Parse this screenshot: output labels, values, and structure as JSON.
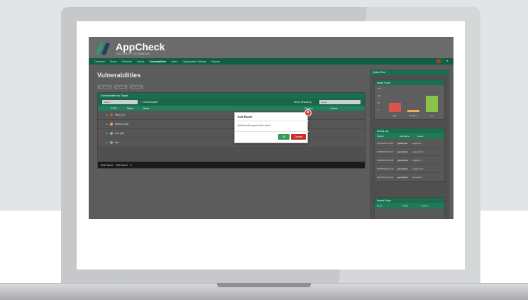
{
  "app": {
    "logo_text": "AppCheck",
    "logo_sub": "SECURITY SCANNING"
  },
  "nav": {
    "items": [
      "Overview",
      "Scans",
      "Schedule",
      "Assets",
      "Vulnerabilities",
      "Users",
      "Organisation Settings",
      "Support"
    ],
    "active": "Vulnerabilities"
  },
  "page": {
    "title": "Vulnerabilities",
    "toolbar": [
      "By Target",
      "By Scan",
      "By Date"
    ]
  },
  "panel": {
    "title": "Vulnerabilities by Target",
    "filter_placeholder": "Search",
    "filter_check": "Hide Accepted",
    "group_label": "Group Results By",
    "group_value": "Target",
    "columns": [
      "CVSS",
      "Status",
      "Name",
      "Scanner",
      "Actions"
    ],
    "rows": [
      {
        "label": "High (12)",
        "color": "#d9534f"
      },
      {
        "label": "Medium (35)",
        "color": "#f0ad4e"
      },
      {
        "label": "Low (86)",
        "color": "#5bc0de"
      },
      {
        "label": "Info",
        "color": "#9e9e9e"
      }
    ],
    "footer": [
      "Bulk Report",
      "Edit Report",
      "0"
    ]
  },
  "side": {
    "title": "Quick View",
    "chart_title": "Issues Found",
    "y_ticks": [
      "150",
      "100",
      "50",
      "0"
    ],
    "chart_colors": {
      "high": "#d9534f",
      "medium": "#f0ad4e",
      "low": "#8bc34a"
    },
    "log_title": "Activity Log",
    "log_cols": [
      "Started",
      "Username",
      "Event"
    ],
    "log_rows": [
      [
        "20/05/2019 11:26",
        "guest@ac",
        "Logged In"
      ],
      [
        "20/05/2019 11:21",
        "guest@ac",
        "Logged Out"
      ],
      [
        "20/05/2019 10:58",
        "guest@ac",
        "Logged In"
      ],
      [
        "20/05/2019 10:41",
        "guest@ac",
        "Logged Out"
      ],
      [
        "20/05/2019 10:12",
        "guest@ac",
        "Scheduled"
      ]
    ],
    "recent_title": "Recent Scans",
    "recent_cols": [
      "Name",
      "Target",
      "Actions"
    ]
  },
  "modal": {
    "title": "Bulk Report",
    "body": "Build a bulk report of the view?",
    "ok": "OK",
    "cancel": "Cancel",
    "close": "×"
  },
  "chart_data": {
    "type": "bar",
    "categories": [
      "High",
      "Medium",
      "Low"
    ],
    "values": [
      60,
      15,
      110
    ],
    "ylim": [
      0,
      150
    ],
    "title": "Issues Found"
  }
}
